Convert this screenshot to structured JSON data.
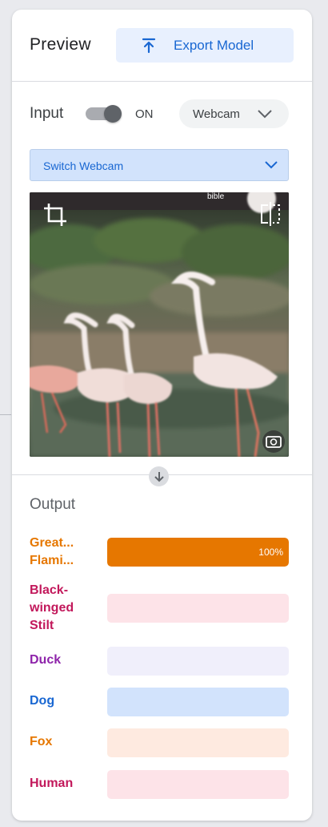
{
  "header": {
    "title": "Preview",
    "export_label": "Export Model"
  },
  "input": {
    "label": "Input",
    "toggle_state": "ON",
    "toggle_on": true,
    "source_value": "Webcam",
    "switch_value": "Switch Webcam"
  },
  "camera": {
    "crop_icon": "crop-icon",
    "flip_icon": "flip-horizontal-icon",
    "snapshot_icon": "camera-switch-icon",
    "overlay_text": "bible"
  },
  "output": {
    "label": "Output",
    "classes": [
      {
        "label": "Great...\nFlami...",
        "percent": 100,
        "percent_label": "100%",
        "color": "#e67700",
        "track": "#fde6d5"
      },
      {
        "label": "Black-\nwinged\nStilt",
        "percent": 0,
        "percent_label": "",
        "color": "#c2185b",
        "track": "#fde3e8"
      },
      {
        "label": "Duck",
        "percent": 0,
        "percent_label": "",
        "color": "#8e24aa",
        "track": "#f0effb"
      },
      {
        "label": "Dog",
        "percent": 0,
        "percent_label": "",
        "color": "#1967d2",
        "track": "#d2e3fc"
      },
      {
        "label": "Fox",
        "percent": 0,
        "percent_label": "",
        "color": "#e67700",
        "track": "#feeae0"
      },
      {
        "label": "Human",
        "percent": 0,
        "percent_label": "",
        "color": "#c2185b",
        "track": "#fde3e8"
      }
    ]
  },
  "colors": {
    "accent": "#1967d2",
    "divider": "#dadce0"
  }
}
